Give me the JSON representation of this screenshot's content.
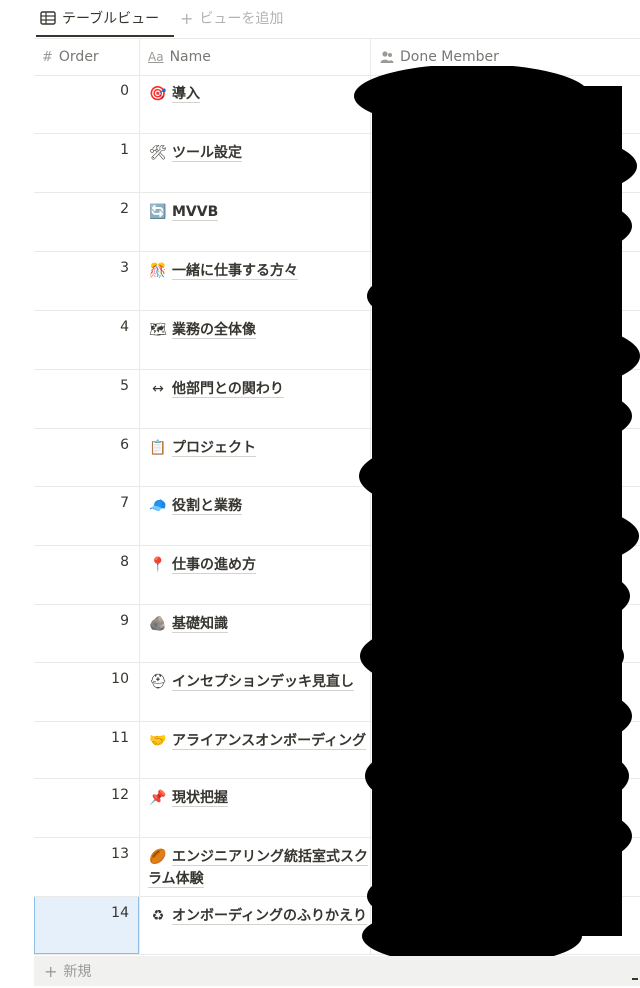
{
  "tabs": {
    "active_label": "テーブルビュー",
    "add_label": "ビューを追加"
  },
  "columns": {
    "order": "Order",
    "name": "Name",
    "done": "Done Member"
  },
  "rows": [
    {
      "order": "0",
      "emoji": "🎯",
      "name": "導入"
    },
    {
      "order": "1",
      "emoji": "🛠",
      "name": "ツール設定"
    },
    {
      "order": "2",
      "emoji": "🔄",
      "name": "MVVB"
    },
    {
      "order": "3",
      "emoji": "🎊",
      "name": "一緒に仕事する方々"
    },
    {
      "order": "4",
      "emoji": "🗺",
      "name": "業務の全体像"
    },
    {
      "order": "5",
      "emoji": "↔",
      "name": "他部門との関わり"
    },
    {
      "order": "6",
      "emoji": "📋",
      "name": "プロジェクト"
    },
    {
      "order": "7",
      "emoji": "🧢",
      "name": "役割と業務"
    },
    {
      "order": "8",
      "emoji": "📍",
      "name": "仕事の進め方"
    },
    {
      "order": "9",
      "emoji": "🪨",
      "name": "基礎知識"
    },
    {
      "order": "10",
      "emoji": "⛑",
      "name": "インセプションデッキ見直し"
    },
    {
      "order": "11",
      "emoji": "🤝",
      "name": "アライアンスオンボーディング"
    },
    {
      "order": "12",
      "emoji": "📌",
      "name": "現状把握"
    },
    {
      "order": "13",
      "emoji": "🏉",
      "name": "エンジニアリング統括室式スクラム体験"
    },
    {
      "order": "14",
      "emoji": "♻",
      "name": "オンボーディングのふりかえり"
    }
  ],
  "footer": {
    "new_label": "新規"
  },
  "icons": {
    "tab": "table-icon",
    "order_col": "number-icon",
    "name_col": "text-aa-icon",
    "done_col": "person-icon",
    "add": "plus-icon"
  }
}
